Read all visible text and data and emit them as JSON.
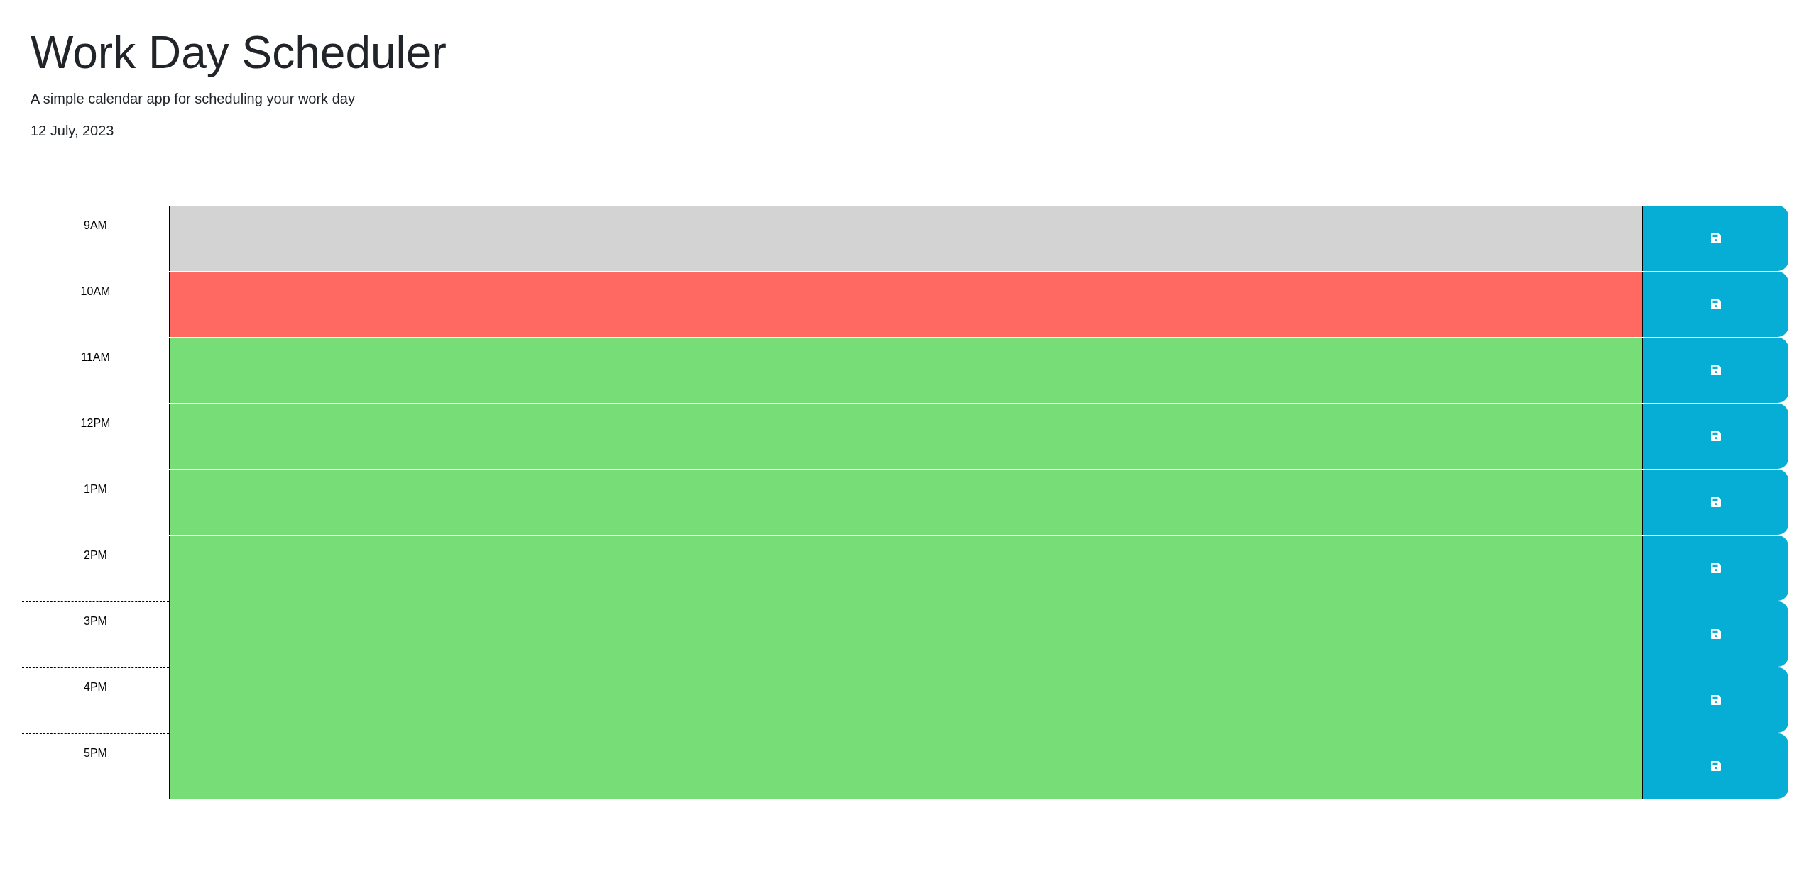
{
  "header": {
    "title": "Work Day Scheduler",
    "subtitle": "A simple calendar app for scheduling your work day",
    "date": "12 July, 2023"
  },
  "time_blocks": [
    {
      "hour": "9AM",
      "color": "#d3d3d3"
    },
    {
      "hour": "10AM",
      "color": "#ff6961"
    },
    {
      "hour": "11AM",
      "color": "#77dd77"
    },
    {
      "hour": "12PM",
      "color": "#77dd77"
    },
    {
      "hour": "1PM",
      "color": "#77dd77"
    },
    {
      "hour": "2PM",
      "color": "#77dd77"
    },
    {
      "hour": "3PM",
      "color": "#77dd77"
    },
    {
      "hour": "4PM",
      "color": "#77dd77"
    },
    {
      "hour": "5PM",
      "color": "#77dd77"
    }
  ]
}
